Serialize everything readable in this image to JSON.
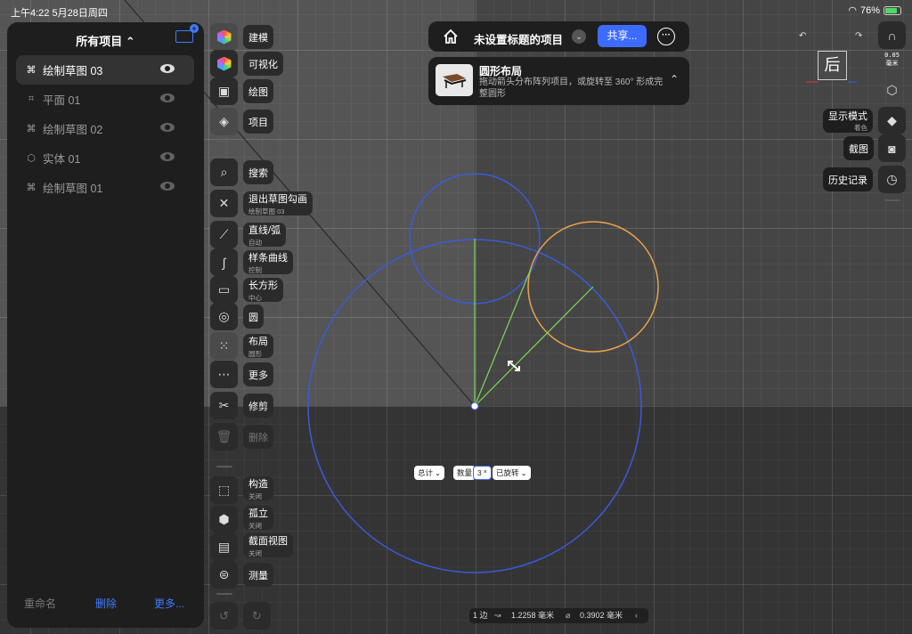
{
  "status_bar": {
    "time_date": "上午4:22  5月28日周四",
    "battery": "76%"
  },
  "left_panel": {
    "title": "所有项目 ⌃",
    "items": [
      {
        "label": "绘制草图 03",
        "icon": "⌘",
        "active": true
      },
      {
        "label": "平面  01",
        "icon": "⌗",
        "active": false
      },
      {
        "label": "绘制草图 02",
        "icon": "⌘",
        "active": false
      },
      {
        "label": "实体  01",
        "icon": "⬡",
        "active": false
      },
      {
        "label": "绘制草图 01",
        "icon": "⌘",
        "active": false
      }
    ],
    "footer": {
      "rename": "重命名",
      "delete": "删除",
      "more": "更多..."
    }
  },
  "toolbar": {
    "modeling": "建模",
    "visualize": "可视化",
    "drawing": "绘图",
    "project": "项目",
    "search": "搜索",
    "exit_sketch": "退出草图勾画",
    "exit_sketch_sub": "绘制草图 03",
    "line_arc": "直线/弧",
    "line_arc_sub": "自动",
    "spline": "样条曲线",
    "spline_sub": "控制",
    "rectangle": "长方形",
    "rectangle_sub": "中心",
    "circle": "圆",
    "layout": "布局",
    "layout_sub": "圆形",
    "more": "更多",
    "trim": "修剪",
    "delete": "删除",
    "construct": "构造",
    "construct_sub": "关闭",
    "isolate": "孤立",
    "isolate_sub": "关闭",
    "section_view": "截面视图",
    "section_view_sub": "关闭",
    "measure": "测量"
  },
  "top_bar": {
    "title": "未设置标题的项目",
    "share": "共享..."
  },
  "info_card": {
    "title": "圆形布局",
    "description": "拖动箭头分布阵列项目，或旋转至 360° 形成完整圆形"
  },
  "right_panel": {
    "unit_value": "0.05",
    "unit_label": "毫米",
    "view_cube_label": "后",
    "display_mode": "显示模式",
    "display_mode_sub": "着色",
    "screenshot": "截图",
    "history": "历史记录"
  },
  "dimension": {
    "total": "总计",
    "quantity": "数量",
    "count": "3",
    "rotated": "已旋转"
  },
  "bottom_status": {
    "edges": "1 边",
    "length": "1.2258 毫米",
    "diameter": "0.3902 毫米"
  },
  "colors": {
    "accent": "#3d6bff",
    "sketch_circle": "#3a5bd9",
    "selected_circle": "#e8a34a",
    "construction_line": "#7ed957"
  }
}
